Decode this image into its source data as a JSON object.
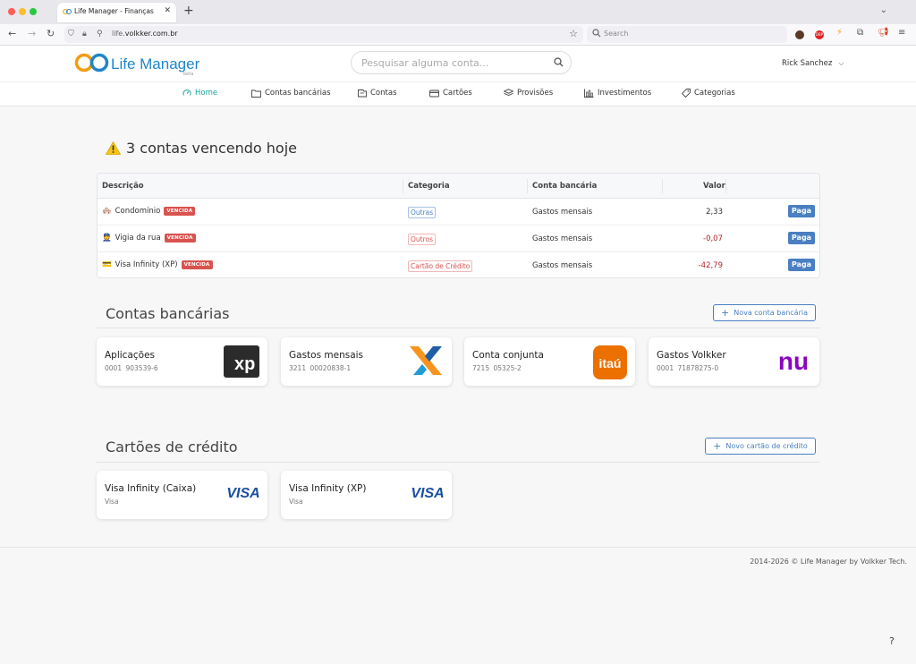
{
  "browser": {
    "tab_title": "Life Manager - Finanças",
    "url_domain": "volkker.com.br",
    "url_prefix": "life.",
    "search_placeholder": "Search",
    "ext_badge": "DBP"
  },
  "header": {
    "logo_text": "Life Manager",
    "logo_badge": "beta",
    "search_placeholder": "Pesquisar alguma conta...",
    "user_name": "Rick Sanchez"
  },
  "nav": [
    {
      "label": "Home",
      "icon": "gauge-icon",
      "active": true
    },
    {
      "label": "Contas bancárias",
      "icon": "folder-icon"
    },
    {
      "label": "Contas",
      "icon": "receipt-icon"
    },
    {
      "label": "Cartões",
      "icon": "credit-card-icon"
    },
    {
      "label": "Provisões",
      "icon": "layers-icon"
    },
    {
      "label": "Investimentos",
      "icon": "bar-chart-icon"
    },
    {
      "label": "Categorias",
      "icon": "tag-icon"
    }
  ],
  "alert": {
    "title": "3 contas vencendo hoje",
    "columns": [
      "Descrição",
      "Categoria",
      "Conta bancária",
      "Valor"
    ],
    "rows": [
      {
        "emoji": "🏘️",
        "description": "Condomínio",
        "badge": "VENCIDA",
        "category": "Outras",
        "category_color": "#4a7fc1",
        "account": "Gastos mensais",
        "value": "2,33",
        "value_color": "#333333",
        "action": "Paga"
      },
      {
        "emoji": "👮",
        "description": "Vigia da rua",
        "badge": "VENCIDA",
        "category": "Outros",
        "category_color": "#d9534f",
        "account": "Gastos mensais",
        "value": "-0,07",
        "value_color": "#b0242a",
        "action": "Paga"
      },
      {
        "emoji": "💳",
        "description": "Visa Infinity (XP)",
        "badge": "VENCIDA",
        "category": "Cartão de Crédito",
        "category_color": "#d9534f",
        "account": "Gastos mensais",
        "value": "-42,79",
        "value_color": "#b0242a",
        "action": "Paga"
      }
    ]
  },
  "bank_accounts": {
    "title": "Contas bancárias",
    "new_button": "Nova conta bancária",
    "items": [
      {
        "name": "Aplicações",
        "agency": "0001",
        "number": "903539-6",
        "logo": "xp"
      },
      {
        "name": "Gastos mensais",
        "agency": "3211",
        "number": "00020838-1",
        "logo": "caixa"
      },
      {
        "name": "Conta conjunta",
        "agency": "7215",
        "number": "05325-2",
        "logo": "itau"
      },
      {
        "name": "Gastos Volkker",
        "agency": "0001",
        "number": "71878275-0",
        "logo": "nubank"
      }
    ],
    "logo_text": {
      "xp": "xp",
      "itau": "itaú",
      "nubank": "nu"
    }
  },
  "credit_cards": {
    "title": "Cartões de crédito",
    "new_button": "Novo cartão de crédito",
    "items": [
      {
        "name": "Visa Infinity (Caixa)",
        "brand": "Visa",
        "logo_text": "VISA"
      },
      {
        "name": "Visa Infinity (XP)",
        "brand": "Visa",
        "logo_text": "VISA"
      }
    ]
  },
  "footer": {
    "copyright": "2014-2026 © Life Manager by Volkker Tech.",
    "help": "?"
  },
  "colors": {
    "accent": "#1aa59a",
    "primary": "#4a7fc1",
    "danger": "#d9534f"
  }
}
